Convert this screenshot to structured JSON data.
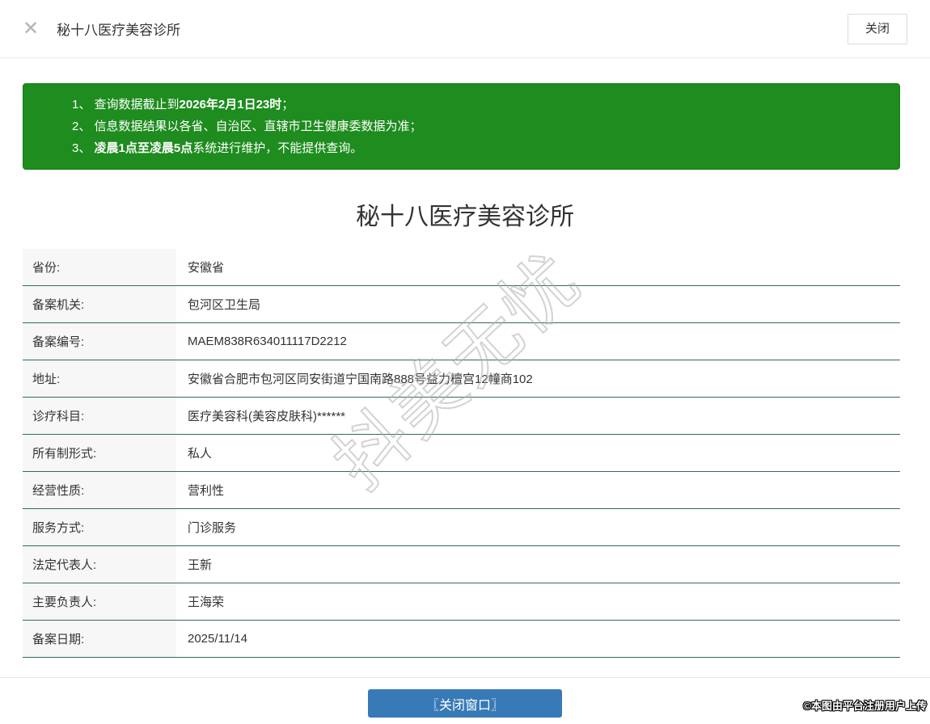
{
  "header": {
    "close_icon": "✕",
    "title": "秘十八医疗美容诊所",
    "close_button_label": "关闭"
  },
  "notice": {
    "lines": [
      {
        "pre": "1、 查询数据截止到",
        "bold": "2026年2月1日23时",
        "post": "；"
      },
      {
        "pre": "2、 信息数据结果以各省、自治区、直辖市卫生健康委数据为准；",
        "bold": "",
        "post": ""
      },
      {
        "pre": "3、 ",
        "bold": "凌晨1点至凌晨5点",
        "post": "系统进行维护，不能提供查询。"
      }
    ]
  },
  "main": {
    "title": "秘十八医疗美容诊所"
  },
  "table": {
    "rows": [
      {
        "label": "省份:",
        "value": "安徽省"
      },
      {
        "label": "备案机关:",
        "value": "包河区卫生局"
      },
      {
        "label": "备案编号:",
        "value": "MAEM838R634011117D2212"
      },
      {
        "label": "地址:",
        "value": "安徽省合肥市包河区同安街道宁国南路888号益力檀宫12幢商102"
      },
      {
        "label": "诊疗科目:",
        "value": "医疗美容科(美容皮肤科)******"
      },
      {
        "label": "所有制形式:",
        "value": "私人"
      },
      {
        "label": "经营性质:",
        "value": "营利性"
      },
      {
        "label": "服务方式:",
        "value": "门诊服务"
      },
      {
        "label": "法定代表人:",
        "value": "王新"
      },
      {
        "label": "主要负责人:",
        "value": "王海荣"
      },
      {
        "label": "备案日期:",
        "value": "2025/11/14"
      }
    ]
  },
  "footer": {
    "close_window_button_label": "〖关闭窗口〗"
  },
  "watermark": {
    "text": "抖美无忧"
  },
  "overlay": {
    "credit": "©本图由平台注册用户上传"
  },
  "colors": {
    "notice_green": "#1e8c1e",
    "table_border_teal": "#2c6e5a",
    "label_cell_bg": "#f7f7f7",
    "button_blue": "#3879b7"
  }
}
